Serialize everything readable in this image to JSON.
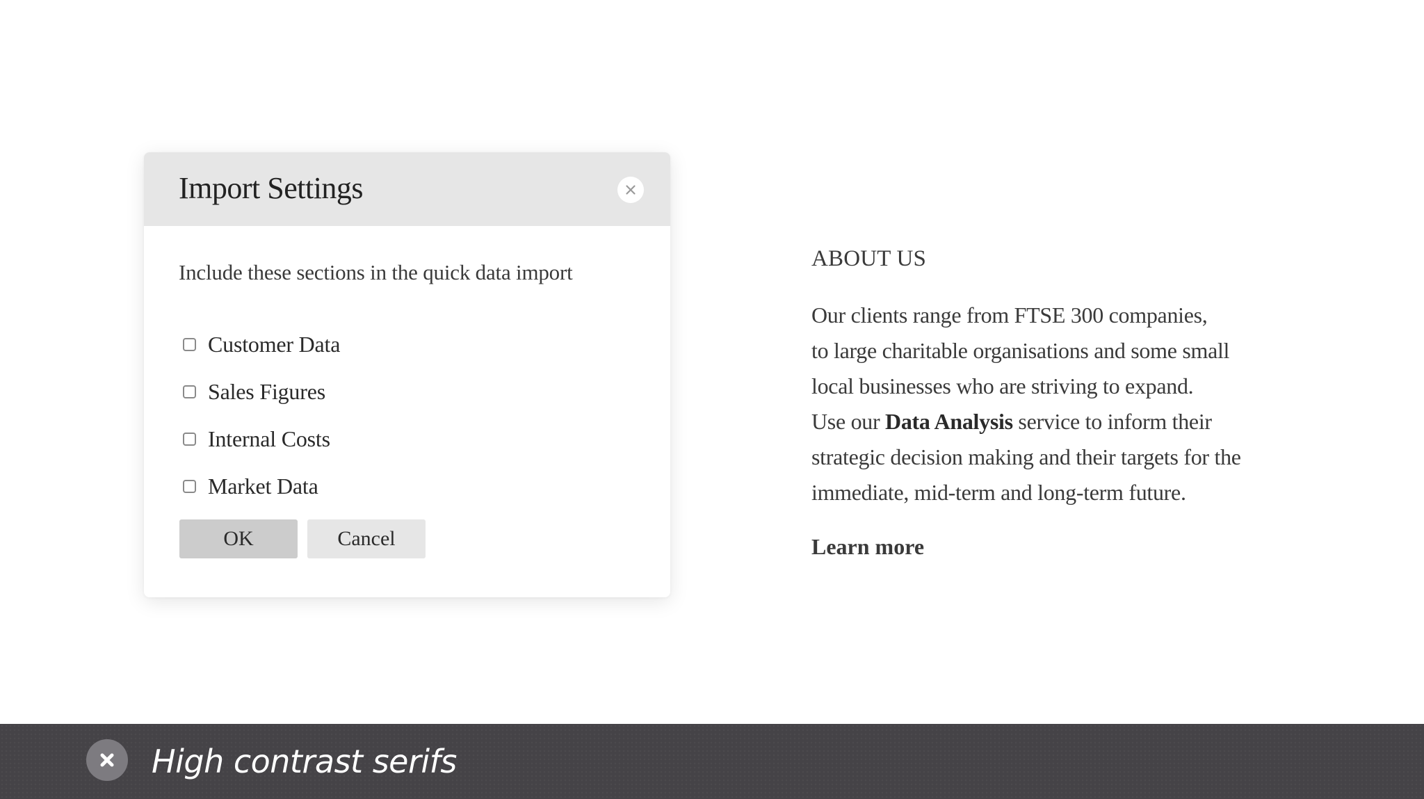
{
  "dialog": {
    "title": "Import Settings",
    "prompt": "Include these sections in the quick data import",
    "options": [
      {
        "label": "Customer Data",
        "checked": false
      },
      {
        "label": "Sales Figures",
        "checked": false
      },
      {
        "label": "Internal Costs",
        "checked": false
      },
      {
        "label": "Market Data",
        "checked": false
      }
    ],
    "ok_label": "OK",
    "cancel_label": "Cancel",
    "close_icon": "close-icon"
  },
  "about": {
    "heading": "ABOUT US",
    "lines": [
      "Our clients range from FTSE 300 companies,",
      "to large charitable organisations and some small",
      "local businesses who are striving to expand."
    ],
    "line4_prefix": "Use our ",
    "line4_bold": "Data Analysis",
    "line4_suffix": " service to inform their",
    "lines_tail": [
      "strategic decision making and their targets for the",
      "immediate, mid-term and long-term future."
    ],
    "learn_more": "Learn more"
  },
  "banner": {
    "text": "High contrast serifs",
    "close_icon": "close-icon"
  },
  "colors": {
    "header_bg": "#e6e6e6",
    "ok_bg": "#cccccc",
    "cancel_bg": "#e6e6e6",
    "banner_bg": "#454347",
    "banner_close_bg": "#7d7b80",
    "text": "#3a3a3a"
  }
}
